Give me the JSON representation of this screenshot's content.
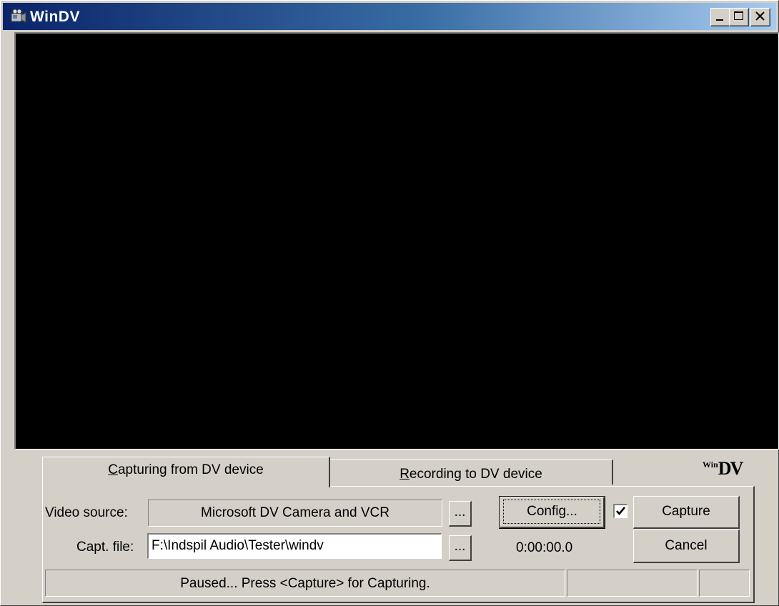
{
  "window": {
    "title": "WinDV",
    "icons": {
      "app": "camcorder-icon",
      "minimize": "minimize-icon",
      "maximize": "maximize-icon",
      "close": "close-icon"
    }
  },
  "tabs": [
    {
      "label_underlined": "C",
      "label_rest": "apturing from DV device",
      "active": true
    },
    {
      "label_underlined": "R",
      "label_rest": "ecording to DV device",
      "active": false
    }
  ],
  "logo": {
    "small": "Win",
    "large": "DV"
  },
  "form": {
    "video_source_label": "Video source:",
    "video_source_value": "Microsoft DV Camera and VCR",
    "browse_label": "...",
    "capt_file_label": "Capt. file:",
    "capt_file_value": "F:\\Indspil Audio\\Tester\\windv",
    "config_label": "Config...",
    "capture_label": "Capture",
    "cancel_label": "Cancel",
    "time": "0:00:00.0",
    "checkbox_checked": true
  },
  "status": {
    "message": "Paused... Press <Capture> for Capturing.",
    "cell2": "",
    "cell3": ""
  }
}
